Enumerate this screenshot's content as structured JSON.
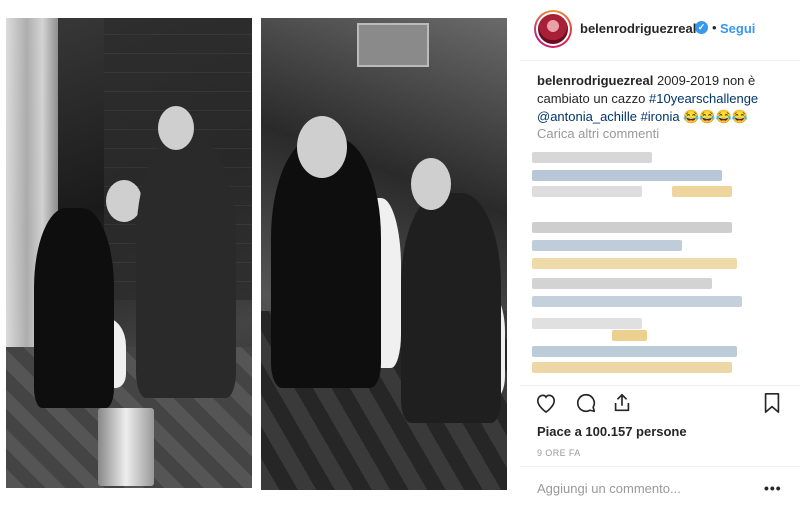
{
  "post": {
    "username": "belenrodriguezreal",
    "verified": true,
    "follow_label": "Segui",
    "separator": "•",
    "caption_user": "belenrodriguezreal",
    "caption_text": "2009-2019 non è cambiato un cazzo",
    "caption_tags": [
      "#10yearschallenge",
      "@antonia_achille",
      "#ironia"
    ],
    "caption_emojis": "😂😂😂😂",
    "load_more_label": "Carica altri commenti",
    "likes_label": "Piace a 100.157 persone",
    "timestamp": "9 ORE FA",
    "comment_placeholder": "Aggiungi un commento...",
    "more_options": "•••"
  },
  "icons": {
    "verified": "verified-badge-icon",
    "like": "heart-icon",
    "comment": "comment-bubble-icon",
    "share": "share-icon",
    "save": "bookmark-icon",
    "more": "more-options-icon"
  },
  "colors": {
    "link": "#3897f0",
    "tag": "#003569",
    "muted": "#999999",
    "text": "#262626"
  }
}
